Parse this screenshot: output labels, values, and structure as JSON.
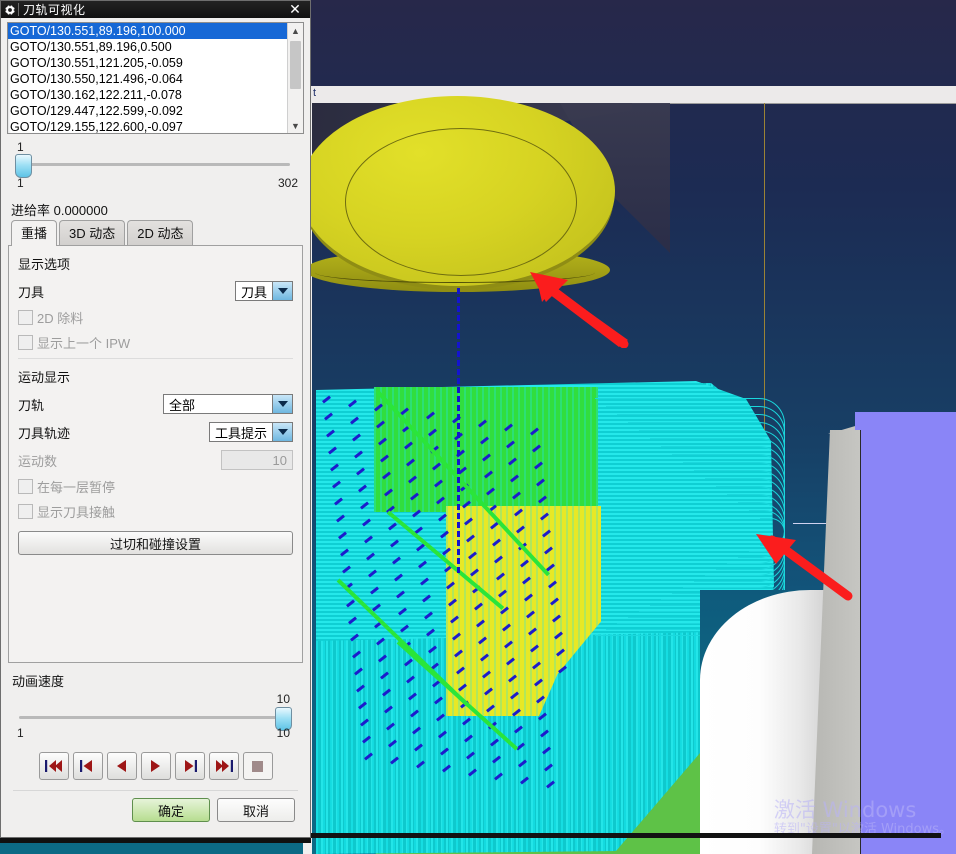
{
  "window": {
    "title": "刀轨可视化",
    "icon": "gear-icon",
    "close_label": "✕"
  },
  "motion_list": {
    "items": [
      "GOTO/130.551,89.196,100.000",
      "GOTO/130.551,89.196,0.500",
      "GOTO/130.551,121.205,-0.059",
      "GOTO/130.550,121.496,-0.064",
      "GOTO/130.162,122.211,-0.078",
      "GOTO/129.447,122.599,-0.092",
      "GOTO/129.155,122.600,-0.097"
    ],
    "selected_index": 0,
    "scroll_up_icon": "chevron-up-icon",
    "scroll_down_icon": "chevron-down-icon"
  },
  "sequence_slider": {
    "current": "1",
    "min": "1",
    "max": "302"
  },
  "feed_rate": {
    "label": "进给率",
    "value": "0.000000",
    "text": "进给率 0.000000"
  },
  "tabs": [
    {
      "label": "重播",
      "active": true
    },
    {
      "label": "3D 动态",
      "active": false
    },
    {
      "label": "2D 动态",
      "active": false
    }
  ],
  "display_options": {
    "title": "显示选项",
    "tool": {
      "label": "刀具",
      "value": "刀具"
    },
    "checkbox_2d_removal": {
      "label": "2D 除料",
      "checked": false,
      "enabled": false
    },
    "checkbox_show_prev_ipw": {
      "label": "显示上一个 IPW",
      "checked": false,
      "enabled": false
    }
  },
  "motion_display": {
    "title": "运动显示",
    "toolpath": {
      "label": "刀轨",
      "value": "全部"
    },
    "tool_trace": {
      "label": "刀具轨迹",
      "value": "工具提示"
    },
    "motion_count": {
      "label": "运动数",
      "value": "10",
      "enabled": false
    },
    "checkbox_pause_each_layer": {
      "label": "在每一层暂停",
      "checked": false,
      "enabled": false
    },
    "checkbox_show_tool_contact": {
      "label": "显示刀具接触",
      "checked": false,
      "enabled": false
    },
    "gouge_button": "过切和碰撞设置"
  },
  "animation_speed": {
    "title": "动画速度",
    "current": "10",
    "min": "1",
    "max": "10"
  },
  "playback": [
    {
      "name": "rewind-to-start-button",
      "icon": "skip-back-double-icon"
    },
    {
      "name": "step-back-button",
      "icon": "skip-back-icon"
    },
    {
      "name": "play-backward-button",
      "icon": "play-left-icon"
    },
    {
      "name": "play-forward-button",
      "icon": "play-right-icon"
    },
    {
      "name": "step-forward-button",
      "icon": "skip-forward-icon"
    },
    {
      "name": "forward-to-end-button",
      "icon": "skip-forward-double-icon"
    },
    {
      "name": "stop-button",
      "icon": "stop-square-icon"
    }
  ],
  "footer": {
    "ok": "确定",
    "cancel": "取消"
  },
  "viewport": {
    "top_label": "t",
    "watermark_line1": "激活 Windows",
    "watermark_line2": "转到\"设置\"以激活 Windows。"
  },
  "colors": {
    "selection_blue": "#1668d6",
    "ok_green": "#b7dd90",
    "tool_yellow": "#d6d322",
    "toolpath_cyan": "#23e5e8",
    "toolpath_green": "#31de3e",
    "toolpath_yellow": "#e8e825",
    "toolpath_blue": "#1c1ccc",
    "stock_purple": "#8a85f7",
    "background_blue": "#174066",
    "annotation_red": "#fb1d1d"
  }
}
